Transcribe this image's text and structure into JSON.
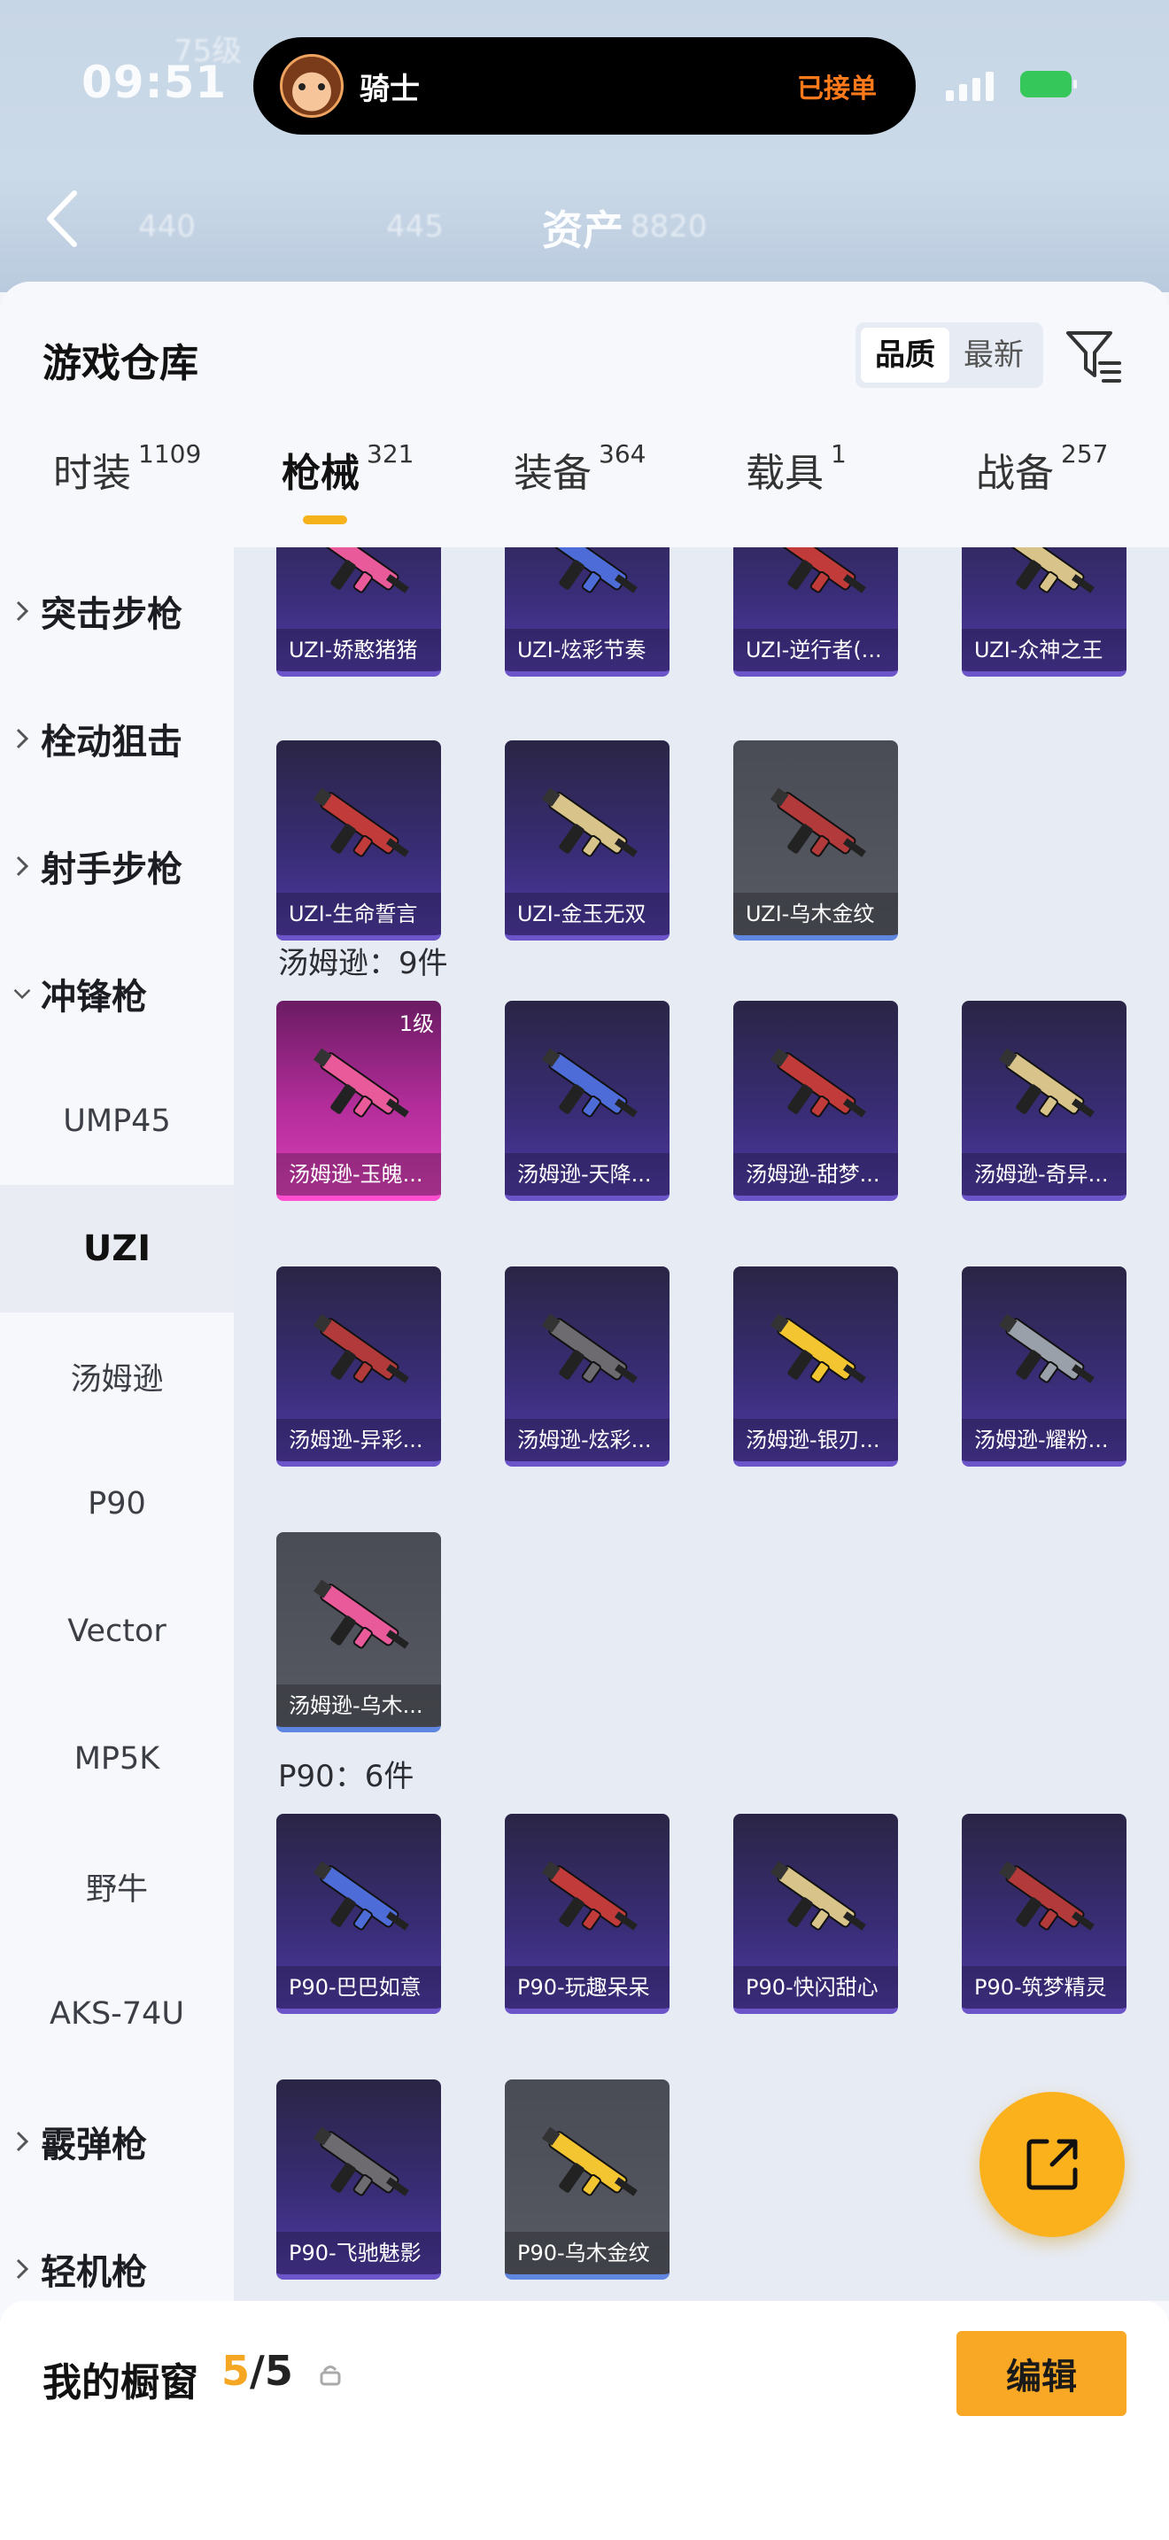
{
  "status": {
    "time": "09:51"
  },
  "island": {
    "name": "骑士",
    "status": "已接单"
  },
  "header": {
    "title": "资产",
    "ghost": [
      "75级",
      "440",
      "445",
      "8820"
    ]
  },
  "sheet": {
    "title": "游戏仓库",
    "sort": [
      "品质",
      "最新"
    ],
    "sort_active": "品质"
  },
  "tabs": [
    {
      "label": "时装",
      "count": "1109"
    },
    {
      "label": "枪械",
      "count": "321"
    },
    {
      "label": "装备",
      "count": "364"
    },
    {
      "label": "载具",
      "count": "1"
    },
    {
      "label": "战备",
      "count": "257"
    }
  ],
  "active_tab": "枪械",
  "sidebar": {
    "categories": [
      {
        "label": "突击步枪",
        "expanded": false
      },
      {
        "label": "栓动狙击",
        "expanded": false
      },
      {
        "label": "射手步枪",
        "expanded": false
      },
      {
        "label": "冲锋枪",
        "expanded": true
      }
    ],
    "subs": [
      "UMP45",
      "UZI",
      "汤姆逊",
      "P90",
      "Vector",
      "MP5K",
      "野牛",
      "AKS-74U"
    ],
    "active_sub": "UZI",
    "categories_after": [
      {
        "label": "霰弹枪",
        "expanded": false
      },
      {
        "label": "轻机枪",
        "expanded": false
      }
    ]
  },
  "uzi_top_row": [
    "UZI-娇憨猪猪",
    "UZI-炫彩节奏",
    "UZI-逆行者(...",
    "UZI-众神之王"
  ],
  "uzi_row2": [
    {
      "name": "UZI-生命誓言",
      "style": "purple"
    },
    {
      "name": "UZI-金玉无双",
      "style": "purple"
    },
    {
      "name": "UZI-乌木金纹",
      "style": "gray"
    }
  ],
  "thompson": {
    "title": "汤姆逊：9件",
    "items": [
      {
        "name": "汤姆逊-玉魄...",
        "style": "pink",
        "level": "1级"
      },
      {
        "name": "汤姆逊-天降...",
        "style": "purple"
      },
      {
        "name": "汤姆逊-甜梦...",
        "style": "purple"
      },
      {
        "name": "汤姆逊-奇异...",
        "style": "purple"
      },
      {
        "name": "汤姆逊-异彩...",
        "style": "purple"
      },
      {
        "name": "汤姆逊-炫彩...",
        "style": "purple"
      },
      {
        "name": "汤姆逊-银刃...",
        "style": "purple"
      },
      {
        "name": "汤姆逊-耀粉...",
        "style": "purple"
      },
      {
        "name": "汤姆逊-乌木...",
        "style": "gray"
      }
    ]
  },
  "p90": {
    "title": "P90：6件",
    "items": [
      {
        "name": "P90-巴巴如意",
        "style": "purple"
      },
      {
        "name": "P90-玩趣呆呆",
        "style": "purple"
      },
      {
        "name": "P90-快闪甜心",
        "style": "purple"
      },
      {
        "name": "P90-筑梦精灵",
        "style": "purple"
      },
      {
        "name": "P90-飞驰魅影",
        "style": "purple"
      },
      {
        "name": "P90-乌木金纹",
        "style": "gray"
      }
    ]
  },
  "showcase": {
    "title": "我的橱窗",
    "used": "5",
    "sep": "/",
    "total": "5",
    "edit": "编辑"
  },
  "colors": {
    "accent": "#f9a826",
    "tab_underline": "#f5b21b",
    "rare_purple": "#4f3aa3",
    "legendary_pink": "#d940b8"
  },
  "icons": [
    "back-arrow-icon",
    "filter-icon",
    "lock-icon",
    "share-icon",
    "chevron-right-icon",
    "chevron-down-icon",
    "gun-icon"
  ]
}
